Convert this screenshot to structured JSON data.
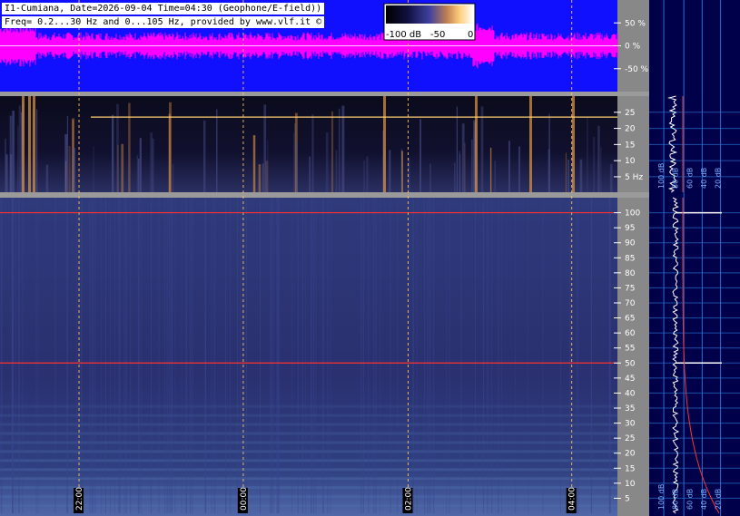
{
  "header": {
    "line1": "I1-Cumiana, Date=2026-09-04 Time=04:30 (Geophone/E-field))",
    "line2": "Freq= 0.2...30 Hz and 0...105 Hz, provided by www.vlf.it ©"
  },
  "colorbar": {
    "labels": [
      "-100 dB",
      "-50",
      "0"
    ]
  },
  "colors": {
    "waveform_bg": "#1010ff",
    "waveform": "#ff00ff",
    "spectrogram_dark": "#0a0a1e",
    "spectrogram_mid": "#26305f",
    "gutter": "#888888",
    "right_panel": "#00004a",
    "marker": "#ffcf70",
    "red_line": "#ff3030"
  },
  "chart_data": [
    {
      "type": "line",
      "panel": "waveform",
      "y_ticks": [
        "50 %",
        "0 %",
        "-50 %"
      ],
      "ylim": [
        -100,
        100
      ]
    },
    {
      "type": "heatmap",
      "panel": "spectrogram-low",
      "y_ticks": [
        "25",
        "20",
        "15",
        "10",
        "5 Hz"
      ],
      "ylim": [
        0.2,
        30
      ],
      "tones": [
        {
          "name": "",
          "freq": 23.5
        }
      ]
    },
    {
      "type": "heatmap",
      "panel": "spectrogram-high",
      "y_ticks": [
        "100",
        "95",
        "90",
        "85",
        "80",
        "75",
        "70",
        "65",
        "60",
        "55",
        "50",
        "45",
        "40",
        "35",
        "30",
        "25",
        "20",
        "15",
        "10",
        "5"
      ],
      "ylim": [
        0,
        105
      ],
      "tones": [
        {
          "name": "",
          "freq": 100
        },
        {
          "name": "",
          "freq": 50
        }
      ],
      "time_labels": [
        "22:00",
        "00:00",
        "02:00",
        "04:00"
      ],
      "time_positions": [
        0.128,
        0.394,
        0.661,
        0.926
      ]
    },
    {
      "type": "line",
      "panel": "spectrum-side",
      "x_ticks": [
        "100 dB",
        "80 dB",
        "60 dB",
        "40 dB",
        "20 dB"
      ],
      "peak_freqs": [
        100,
        50
      ]
    }
  ]
}
